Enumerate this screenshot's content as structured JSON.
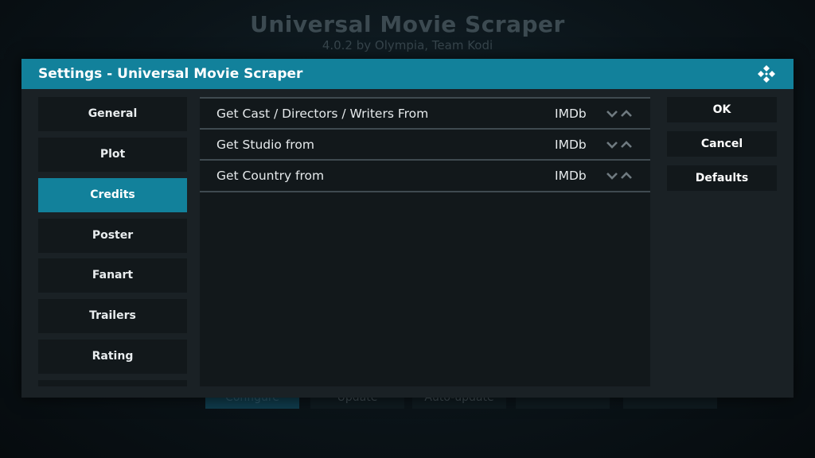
{
  "background": {
    "title": "Universal Movie Scraper",
    "subtitle": "4.0.2 by Olympia, Team Kodi",
    "buttons": [
      "Configure",
      "Update",
      "Auto-update",
      "",
      ""
    ]
  },
  "dialog": {
    "title": "Settings - Universal Movie Scraper",
    "logo_icon": "kodi-logo-icon",
    "accent_color": "#12819b"
  },
  "sidebar": {
    "items": [
      {
        "label": "General"
      },
      {
        "label": "Plot"
      },
      {
        "label": "Credits",
        "selected": true
      },
      {
        "label": "Poster"
      },
      {
        "label": "Fanart"
      },
      {
        "label": "Trailers"
      },
      {
        "label": "Rating"
      },
      {
        "label": ""
      }
    ]
  },
  "settings": {
    "rows": [
      {
        "label": "Get Cast / Directors / Writers From",
        "value": "IMDb"
      },
      {
        "label": "Get Studio from",
        "value": "IMDb"
      },
      {
        "label": "Get Country from",
        "value": "IMDb"
      }
    ]
  },
  "actions": {
    "ok_label": "OK",
    "cancel_label": "Cancel",
    "defaults_label": "Defaults"
  }
}
